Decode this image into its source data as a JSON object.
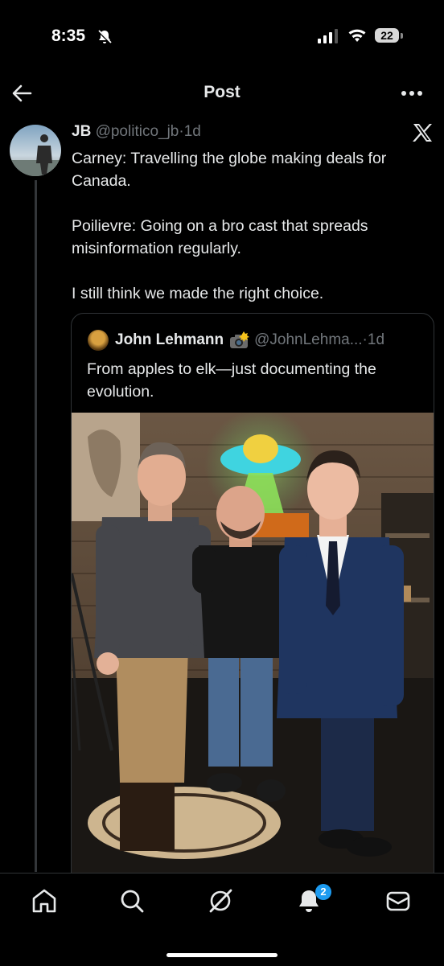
{
  "status_bar": {
    "time": "8:35",
    "battery": "22"
  },
  "top_bar": {
    "title": "Post"
  },
  "tweet": {
    "author_name": "JB",
    "author_handle": "@politico_jb",
    "separator": "·",
    "time_ago": "1d",
    "paragraphs": [
      "Carney: Travelling the globe making deals for Canada.",
      "Poilievre: Going on a bro cast that spreads misinformation regularly.",
      "I still think we made the right choice."
    ]
  },
  "quoted_tweet": {
    "author_name": "John Lehmann",
    "author_handle": "@JohnLehma...",
    "separator": "·",
    "time_ago": "1d",
    "text": "From apples to elk—just documenting the evolution."
  },
  "tab_bar": {
    "items": [
      "home",
      "search",
      "grok",
      "notifications",
      "messages"
    ],
    "notifications_badge": "2"
  },
  "colors": {
    "background": "#000000",
    "text_primary": "#e7e9ea",
    "text_secondary": "#71767b",
    "border": "#2f3336",
    "accent": "#1d9bf0"
  },
  "icons": {
    "back": "arrow-left-icon",
    "more": "more-horizontal-icon",
    "brand": "x-logo-icon",
    "camera": "camera-flash-emoji"
  }
}
